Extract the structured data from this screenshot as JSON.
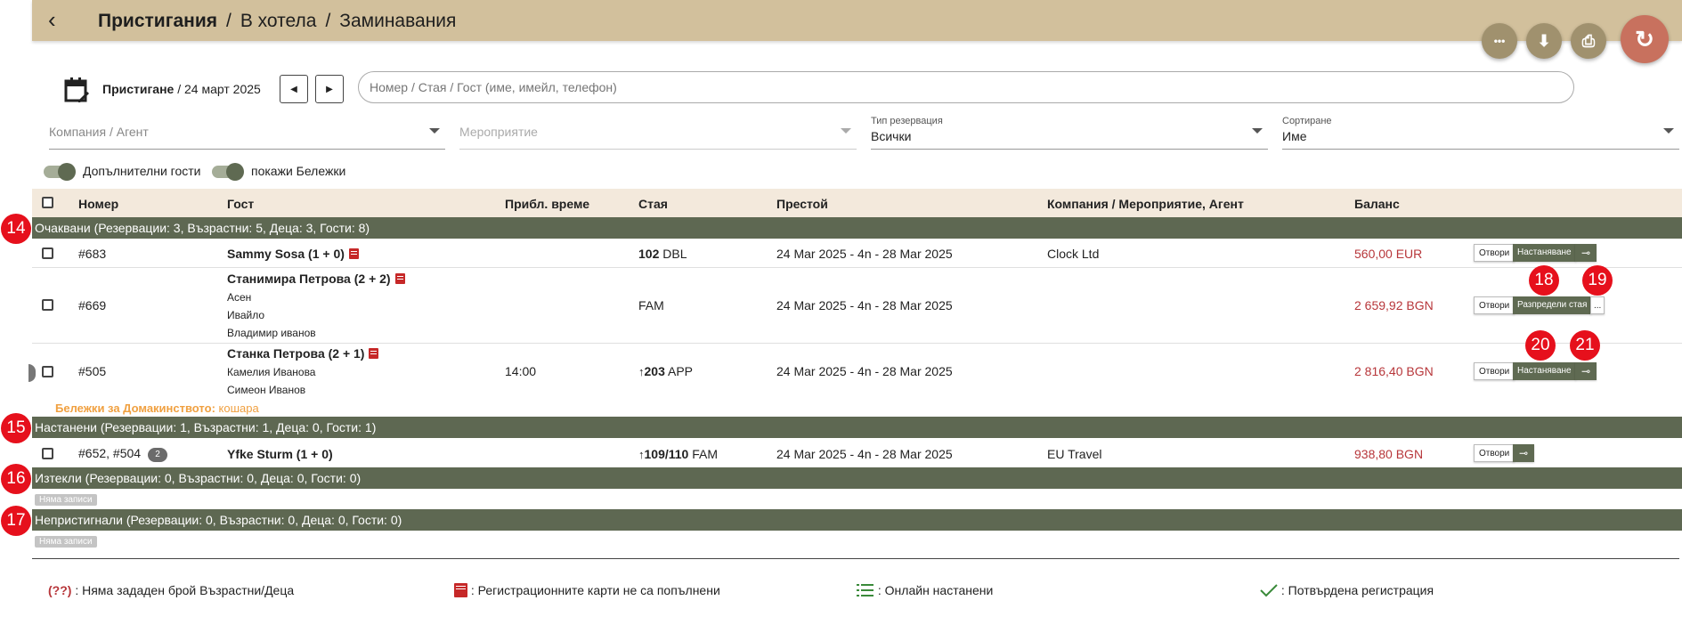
{
  "header": {
    "back_icon": "‹",
    "crumb1": "Пристигания",
    "sep": "/",
    "crumb2": "В хотела",
    "crumb3": "Заминавания",
    "actions": {
      "more": "•••",
      "download": "⬇",
      "print": "⎙",
      "refresh": "↻"
    }
  },
  "filters": {
    "date_prefix": "Пристигане",
    "date_value": " / 24 март 2025",
    "prev": "◀",
    "next": "▶",
    "search_placeholder": "Номер / Стая / Гост (име, имейл, телефон)",
    "company_placeholder": "Компания / Агент",
    "event_placeholder": "Мероприятие",
    "res_type_label": "Тип резервация",
    "res_type_value": "Всички",
    "sort_label": "Сортиране",
    "sort_value": "Име",
    "toggle1": "Допълнителни гости",
    "toggle2": "покажи Бележки"
  },
  "table": {
    "columns": [
      "Номер",
      "Гост",
      "Прибл. време",
      "Стая",
      "Престой",
      "Компания / Мероприятие, Агент",
      "Баланс"
    ]
  },
  "groups": {
    "expected": "Очаквани (Резервации: 3, Възрастни: 5, Деца: 3, Гости: 8)",
    "checked_in": "Настанени (Резервации: 1, Възрастни: 1, Деца: 0, Гости: 1)",
    "departed": "Изтекли (Резервации: 0, Възрастни: 0, Деца: 0, Гости: 0)",
    "no_show": "Непристигнали (Резервации: 0, Възрастни: 0, Деца: 0, Гости: 0)",
    "no_records": "Няма записи"
  },
  "badges": {
    "b14": "14",
    "b15": "15",
    "b16": "16",
    "b17": "17",
    "b18": "18",
    "b19": "19",
    "b20": "20",
    "b21": "21"
  },
  "rows": [
    {
      "number": "#683",
      "guest": "Sammy Sosa (1 + 0)",
      "room_num": "102",
      "room_type": " DBL",
      "stay": "24 Mar 2025 - 4n - 28 Mar 2025",
      "company": "Clock Ltd",
      "balance": "560,00 EUR"
    },
    {
      "number": "#669",
      "guest": "Станимира Петрова (2 + 2)",
      "extra": [
        "Асен",
        "Ивайло",
        "Владимир иванов"
      ],
      "room_type": "FAM",
      "stay": "24 Mar 2025 - 4n - 28 Mar 2025",
      "balance": "2 659,92 BGN"
    },
    {
      "number": "#505",
      "guest": "Станка Петрова (2 + 1)",
      "extra": [
        "Камелия Иванова",
        "Симеон Иванов"
      ],
      "time": "14:00",
      "room_num": "203",
      "room_type": " APP",
      "stay": "24 Mar 2025 - 4n - 28 Mar 2025",
      "balance": "2 816,40 BGN",
      "note_label": "Бележки за Домакинството:",
      "note_value": " кошара"
    },
    {
      "number": "#652, #504",
      "count": "2",
      "guest": "Yfke Sturm (1 + 0)",
      "room_num": "109/110",
      "room_type": " FAM",
      "stay": "24 Mar 2025 - 4n - 28 Mar 2025",
      "company": "EU Travel",
      "balance": "938,80 BGN"
    }
  ],
  "buttons": {
    "open": "Отвори",
    "checkin": "Настаняване",
    "assign": "Разпредели стая",
    "dots": "...",
    "key": "⊸",
    "up": "↑"
  },
  "legend": {
    "l1_mark": "(??)",
    "l1_text": " : Няма зададен брой Възрастни/Деца",
    "l2_text": " : Регистрационните карти не са попълнени",
    "l3_text": " : Онлайн настанени",
    "l4_text": " : Потвърдена регистрация"
  },
  "colors": {
    "header": "#d2c09c",
    "group_bar": "#5e6852",
    "badge": "#e6101c",
    "balance": "#b7363a",
    "note": "#f0a040"
  }
}
